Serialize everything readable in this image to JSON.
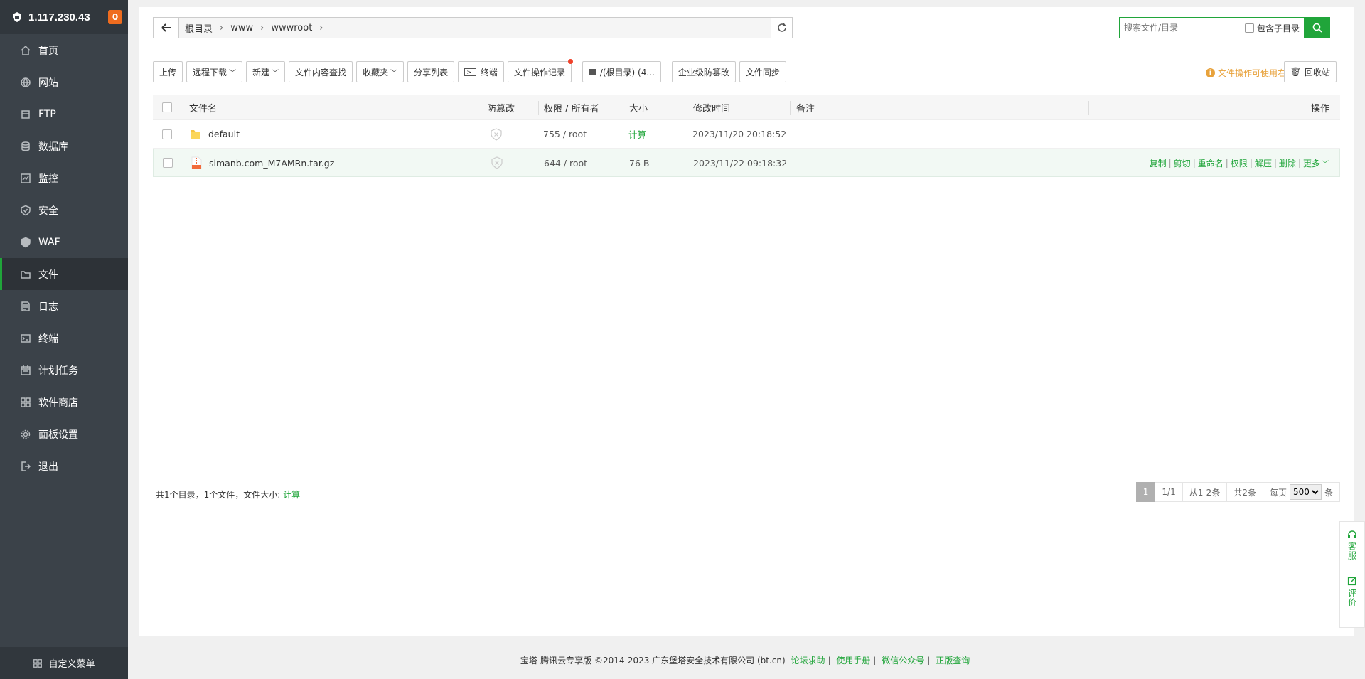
{
  "server": {
    "ip": "1.117.230.43",
    "badge": "0"
  },
  "sidebar": {
    "items": [
      {
        "label": "首页",
        "icon": "home-icon"
      },
      {
        "label": "网站",
        "icon": "globe-icon"
      },
      {
        "label": "FTP",
        "icon": "ftp-icon"
      },
      {
        "label": "数据库",
        "icon": "database-icon"
      },
      {
        "label": "监控",
        "icon": "monitor-icon"
      },
      {
        "label": "安全",
        "icon": "shield-icon"
      },
      {
        "label": "WAF",
        "icon": "waf-shield-icon"
      },
      {
        "label": "文件",
        "icon": "folder-icon"
      },
      {
        "label": "日志",
        "icon": "log-icon"
      },
      {
        "label": "终端",
        "icon": "terminal-icon"
      },
      {
        "label": "计划任务",
        "icon": "calendar-icon"
      },
      {
        "label": "软件商店",
        "icon": "apps-icon"
      },
      {
        "label": "面板设置",
        "icon": "gear-icon"
      },
      {
        "label": "退出",
        "icon": "logout-icon"
      }
    ],
    "active": "文件",
    "footer": "自定义菜单"
  },
  "path": {
    "crumbs": [
      "根目录",
      "www",
      "wwwroot"
    ]
  },
  "search": {
    "placeholder": "搜索文件/目录",
    "include_sub": "包含子目录"
  },
  "toolbar": {
    "upload": "上传",
    "remote_download": "远程下载",
    "new": "新建",
    "content_search": "文件内容查找",
    "favorites": "收藏夹",
    "share_list": "分享列表",
    "terminal": "终端",
    "op_log": "文件操作记录",
    "disk": "/(根目录) (4...",
    "tamper": "企业级防篡改",
    "sync": "文件同步",
    "tip": "文件操作可使用右键",
    "recycle": "回收站"
  },
  "table": {
    "headers": {
      "name": "文件名",
      "tamper": "防篡改",
      "perm": "权限 / 所有者",
      "size": "大小",
      "mtime": "修改时间",
      "note": "备注",
      "ops": "操作"
    },
    "rows": [
      {
        "name": "default",
        "type": "folder",
        "perm": "755 / root",
        "size": "计算",
        "mtime": "2023/11/20 20:18:52"
      },
      {
        "name": "simanb.com_M7AMRn.tar.gz",
        "type": "archive",
        "perm": "644 / root",
        "size": "76 B",
        "mtime": "2023/11/22 09:18:32"
      }
    ],
    "row_ops": [
      "复制",
      "剪切",
      "重命名",
      "权限",
      "解压",
      "删除",
      "更多"
    ]
  },
  "summary": {
    "text": "共1个目录，1个文件，文件大小:",
    "calc": "计算"
  },
  "pager": {
    "current": "1",
    "pages": "1/1",
    "range": "从1-2条",
    "total": "共2条",
    "per_page_label": "每页",
    "per_page": "500",
    "unit": "条"
  },
  "footer": {
    "copyright": "宝塔-腾讯云专享版 ©2014-2023 广东堡塔安全技术有限公司 (bt.cn)",
    "links": [
      "论坛求助",
      "使用手册",
      "微信公众号",
      "正版查询"
    ]
  },
  "float": {
    "service": "客服",
    "review": "评价"
  },
  "colors": {
    "accent": "#20a53a",
    "sidebar": "#3b4249",
    "badge": "#ef6c1f",
    "tip": "#e8a23b"
  }
}
